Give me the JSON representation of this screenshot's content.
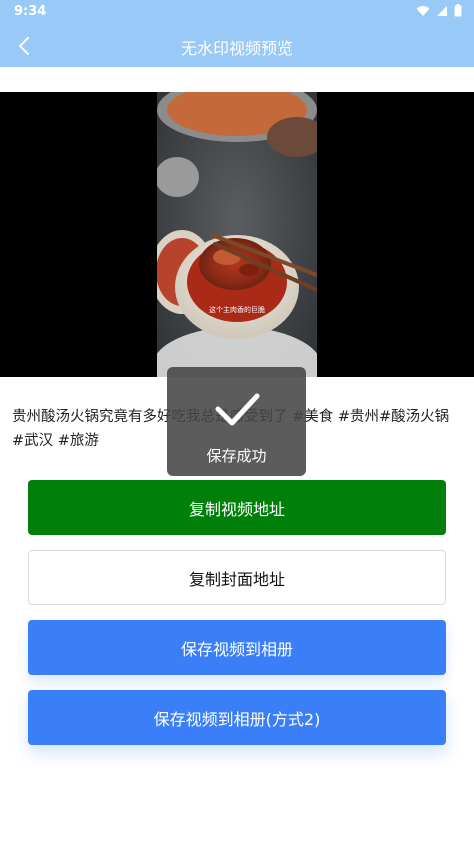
{
  "status": {
    "time": "9:34"
  },
  "header": {
    "title": "无水印视频预览"
  },
  "video": {
    "subtitle": "这个主肉香的巨脆"
  },
  "caption": "贵州酸汤火锅究竟有多好吃我总是感受到了 #美食 #贵州#酸汤火锅 #武汉 #旅游",
  "buttons": {
    "copy_video": "复制视频地址",
    "copy_cover": "复制封面地址",
    "save_album": "保存视频到相册",
    "save_album_alt": "保存视频到相册(方式2)"
  },
  "toast": {
    "message": "保存成功"
  },
  "colors": {
    "header": "#99c9f7",
    "green_button": "#00800a",
    "blue_button": "#3a7ff7"
  }
}
